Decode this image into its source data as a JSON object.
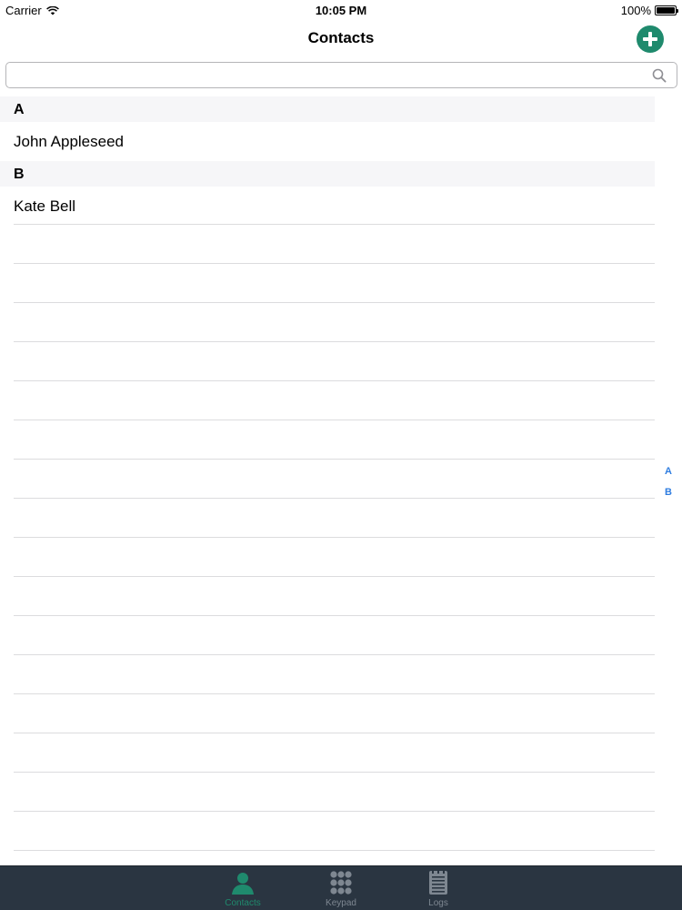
{
  "status_bar": {
    "carrier": "Carrier",
    "time": "10:05 PM",
    "battery": "100%"
  },
  "nav": {
    "title": "Contacts",
    "add_icon": "plus-circle-icon"
  },
  "search": {
    "value": "",
    "placeholder": "",
    "icon": "search-icon"
  },
  "sections": [
    {
      "letter": "A",
      "contacts": [
        "John Appleseed"
      ]
    },
    {
      "letter": "B",
      "contacts": [
        "Kate Bell"
      ]
    }
  ],
  "index": [
    "A",
    "B"
  ],
  "tabs": [
    {
      "label": "Contacts",
      "icon": "person-icon",
      "active": true
    },
    {
      "label": "Keypad",
      "icon": "keypad-icon",
      "active": false
    },
    {
      "label": "Logs",
      "icon": "list-icon",
      "active": false
    }
  ],
  "colors": {
    "accent": "#1f8a6d",
    "index": "#2f7de0",
    "tab_bar": "#2a3541",
    "tab_inactive": "#7e8791",
    "section_bg": "#f6f6f8"
  }
}
